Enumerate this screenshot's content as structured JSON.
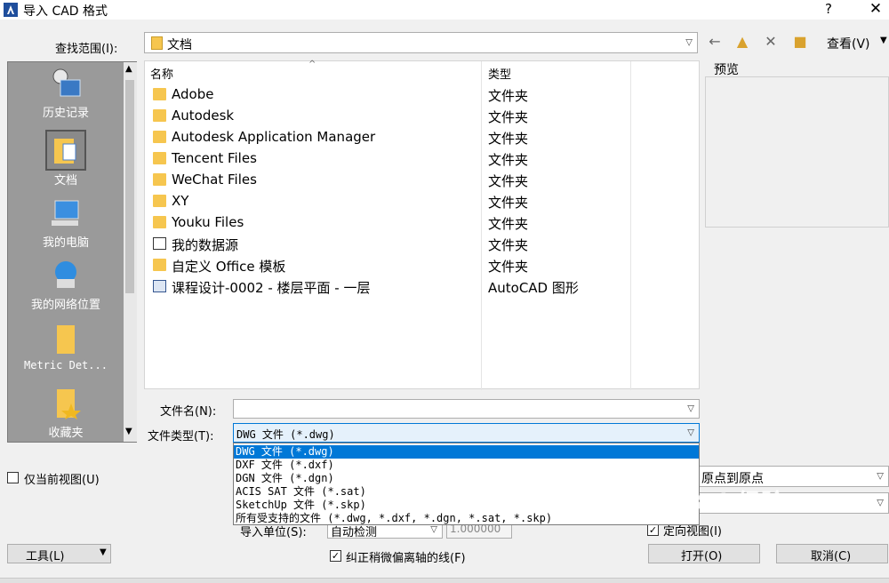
{
  "window": {
    "title": "导入 CAD 格式",
    "help": "?",
    "close": "✕"
  },
  "lookin": {
    "label": "查找范围(I):",
    "value": "文档",
    "view_label": "查看(V)"
  },
  "toolbar": {
    "back": "🡐",
    "up": "📁",
    "delete": "✕",
    "newfolder": "📁"
  },
  "places": [
    {
      "label": "历史记录",
      "icon": "history-icon"
    },
    {
      "label": "文档",
      "icon": "documents-icon"
    },
    {
      "label": "我的电脑",
      "icon": "computer-icon"
    },
    {
      "label": "我的网络位置",
      "icon": "network-icon"
    },
    {
      "label": "Metric Det...",
      "icon": "folder-icon"
    },
    {
      "label": "收藏夹",
      "icon": "favorites-icon"
    }
  ],
  "filelist": {
    "headers": {
      "name": "名称",
      "type": "类型"
    },
    "rows": [
      {
        "name": "Adobe",
        "type": "文件夹"
      },
      {
        "name": "Autodesk",
        "type": "文件夹"
      },
      {
        "name": "Autodesk Application Manager",
        "type": "文件夹"
      },
      {
        "name": "Tencent Files",
        "type": "文件夹"
      },
      {
        "name": "WeChat Files",
        "type": "文件夹"
      },
      {
        "name": "XY",
        "type": "文件夹"
      },
      {
        "name": "Youku Files",
        "type": "文件夹"
      },
      {
        "name": "我的数据源",
        "type": "文件夹"
      },
      {
        "name": "自定义 Office 模板",
        "type": "文件夹"
      },
      {
        "name": "课程设计-0002 - 楼层平面 - 一层",
        "type": "AutoCAD 图形"
      }
    ]
  },
  "preview": {
    "label": "预览"
  },
  "filename": {
    "label": "文件名(N):",
    "value": ""
  },
  "filetype": {
    "label": "文件类型(T):",
    "value": "DWG 文件 (*.dwg)",
    "options": [
      "DWG 文件 (*.dwg)",
      "DXF 文件 (*.dxf)",
      "DGN 文件 (*.dgn)",
      "ACIS SAT 文件 (*.sat)",
      "SketchUp 文件 (*.skp)",
      "所有受支持的文件 (*.dwg, *.dxf, *.dgn, *.sat, *.skp)"
    ]
  },
  "options": {
    "current_view_only": "仅当前视图(U)",
    "origin_to_origin": "原点到原点",
    "import_units_label": "导入单位(S):",
    "import_units_value": "自动检测",
    "scale_value": "1.000000",
    "orient_view": "定向视图(I)",
    "correct_lines": "纠正稍微偏离轴的线(F)"
  },
  "buttons": {
    "tools": "工具(L)",
    "open": "打开(O)",
    "cancel": "取消(C)"
  },
  "watermark": "Bai 经验"
}
